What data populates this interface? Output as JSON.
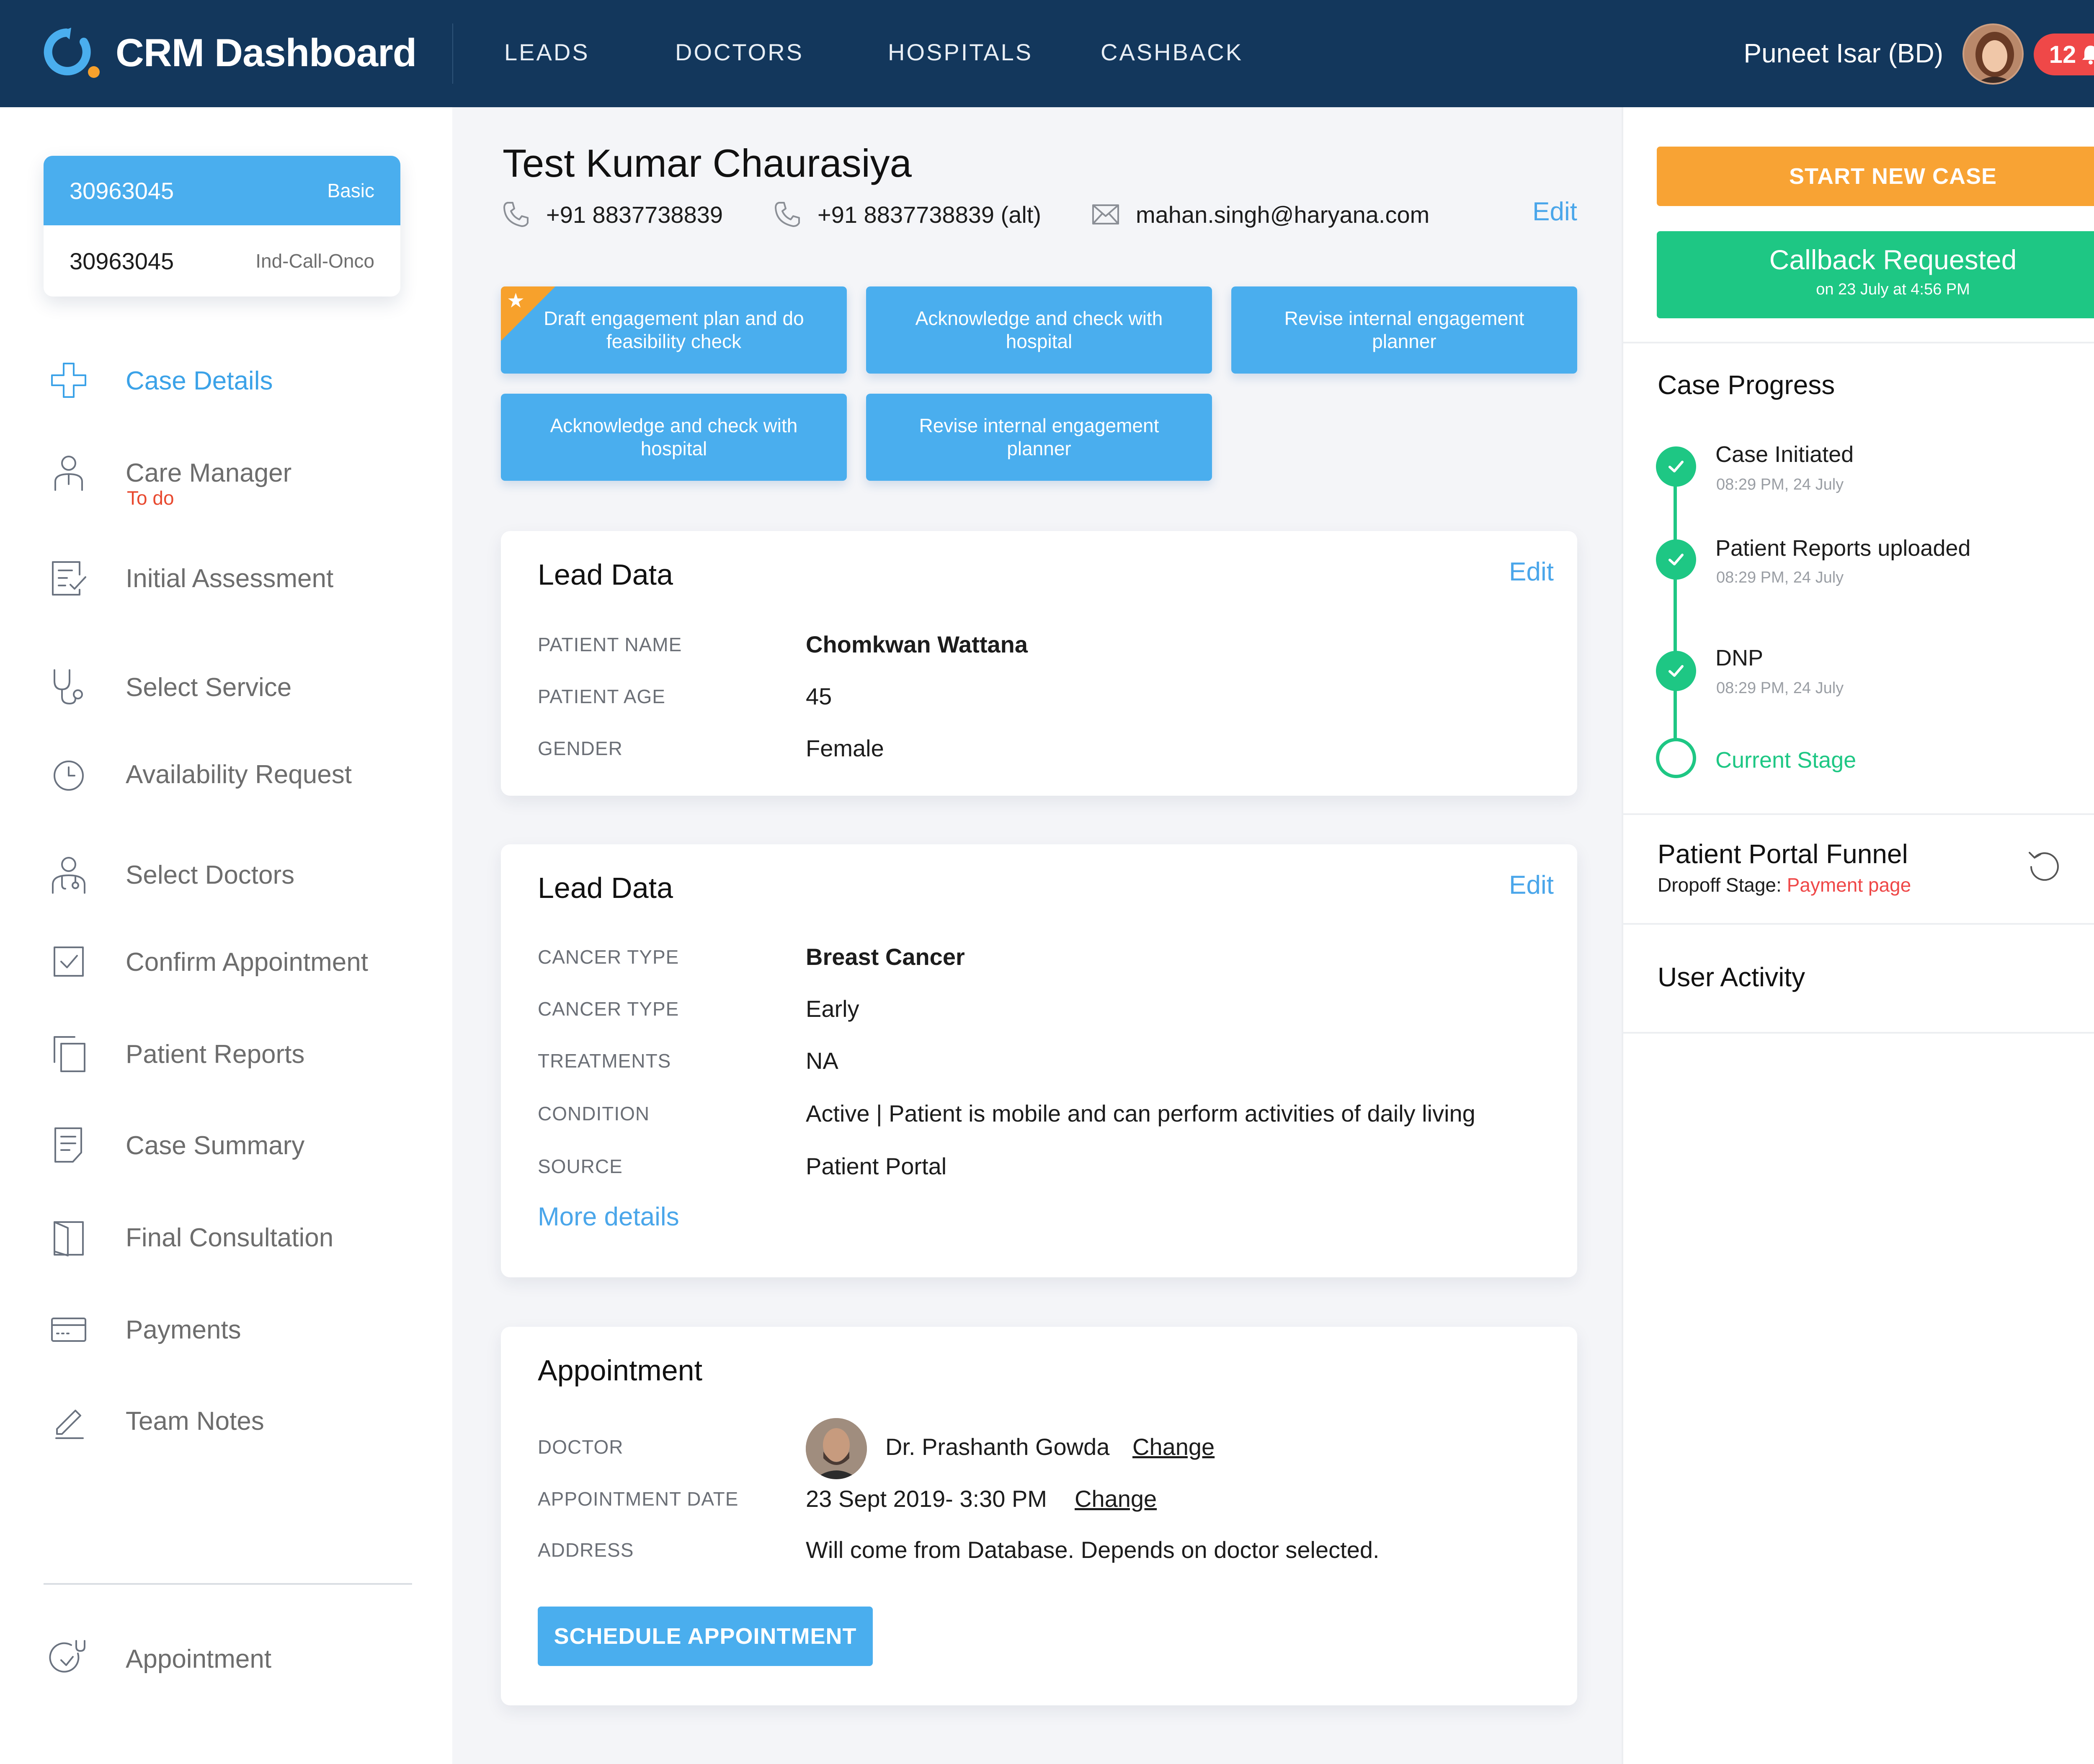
{
  "header": {
    "app_title": "CRM Dashboard",
    "nav": [
      "LEADS",
      "DOCTORS",
      "HOSPITALS",
      "CASHBACK"
    ],
    "user_name": "Puneet Isar (BD)",
    "notification_count": "12",
    "brand_color": "#13375c",
    "logo_accent": "#f7a12c"
  },
  "case_selector": {
    "primary": {
      "id": "30963045",
      "tag": "Basic"
    },
    "secondary": {
      "id": "30963045",
      "tag": "Ind-Call-Onco"
    }
  },
  "sidebar": {
    "items": [
      {
        "label": "Case Details",
        "icon": "medical-cross-icon",
        "active": true
      },
      {
        "label": "Care Manager",
        "sub": "To do",
        "icon": "care-manager-icon"
      },
      {
        "label": "Initial Assessment",
        "icon": "checklist-icon"
      },
      {
        "label": "Select Service",
        "icon": "stethoscope-icon"
      },
      {
        "label": "Availability Request",
        "icon": "clock-icon"
      },
      {
        "label": "Select Doctors",
        "icon": "doctor-icon"
      },
      {
        "label": "Confirm Appointment",
        "icon": "checkbox-icon"
      },
      {
        "label": "Patient Reports",
        "icon": "copy-icon"
      },
      {
        "label": "Case Summary",
        "icon": "document-icon"
      },
      {
        "label": "Final Consultation",
        "icon": "book-icon"
      },
      {
        "label": "Payments",
        "icon": "credit-card-icon"
      },
      {
        "label": "Team Notes",
        "icon": "pencil-icon"
      }
    ],
    "footer_item": {
      "label": "Appointment",
      "icon": "appointment-icon"
    }
  },
  "patient": {
    "name": "Test Kumar Chaurasiya",
    "phone": "+91 8837738839",
    "phone_alt": "+91 8837738839 (alt)",
    "email": "mahan.singh@haryana.com",
    "edit_label": "Edit"
  },
  "tasks": [
    {
      "label": "Draft engagement plan and do feasibility check",
      "starred": true
    },
    {
      "label": "Acknowledge and check with hospital"
    },
    {
      "label": "Revise internal engagement planner"
    },
    {
      "label": "Acknowledge and check with hospital"
    },
    {
      "label": "Revise internal engagement planner"
    }
  ],
  "lead_data_1": {
    "title": "Lead Data",
    "edit_label": "Edit",
    "rows": [
      {
        "key": "PATIENT NAME",
        "value": "Chomkwan Wattana"
      },
      {
        "key": "PATIENT AGE",
        "value": "45"
      },
      {
        "key": "GENDER",
        "value": "Female"
      }
    ]
  },
  "lead_data_2": {
    "title": "Lead Data",
    "edit_label": "Edit",
    "rows": [
      {
        "key": "CANCER TYPE",
        "value": "Breast Cancer"
      },
      {
        "key": "CANCER TYPE",
        "value": "Early"
      },
      {
        "key": "TREATMENTS",
        "value": "NA"
      },
      {
        "key": "CONDITION",
        "value": "Active | Patient is mobile and can perform activities of daily living"
      },
      {
        "key": "SOURCE",
        "value": "Patient Portal"
      }
    ],
    "more_label": "More details"
  },
  "appointment": {
    "title": "Appointment",
    "doctor_key": "DOCTOR",
    "doctor_value": "Dr. Prashanth  Gowda",
    "date_key": "APPOINTMENT DATE",
    "date_value": "23 Sept 2019- 3:30 PM",
    "address_key": "ADDRESS",
    "address_value": "Will come from Database. Depends on doctor selected.",
    "change_label": "Change",
    "button_label": "SCHEDULE APPOINTMENT"
  },
  "right_panel": {
    "start_case_label": "START NEW CASE",
    "callback_title": "Callback Requested",
    "callback_sub": "on 23 July at 4:56 PM",
    "progress_title": "Case Progress",
    "steps": [
      {
        "label": "Case Initiated",
        "time": "08:29 PM, 24 July"
      },
      {
        "label": "Patient Reports uploaded",
        "time": "08:29 PM, 24 July"
      },
      {
        "label": "DNP",
        "time": "08:29 PM, 24 July"
      }
    ],
    "current_stage_label": "Current Stage",
    "funnel_title": "Patient Portal Funnel",
    "funnel_key": "Dropoff Stage:",
    "funnel_value": "Payment page",
    "activity_title": "User Activity",
    "accent_green": "#1ec784",
    "accent_orange": "#f8a334"
  }
}
